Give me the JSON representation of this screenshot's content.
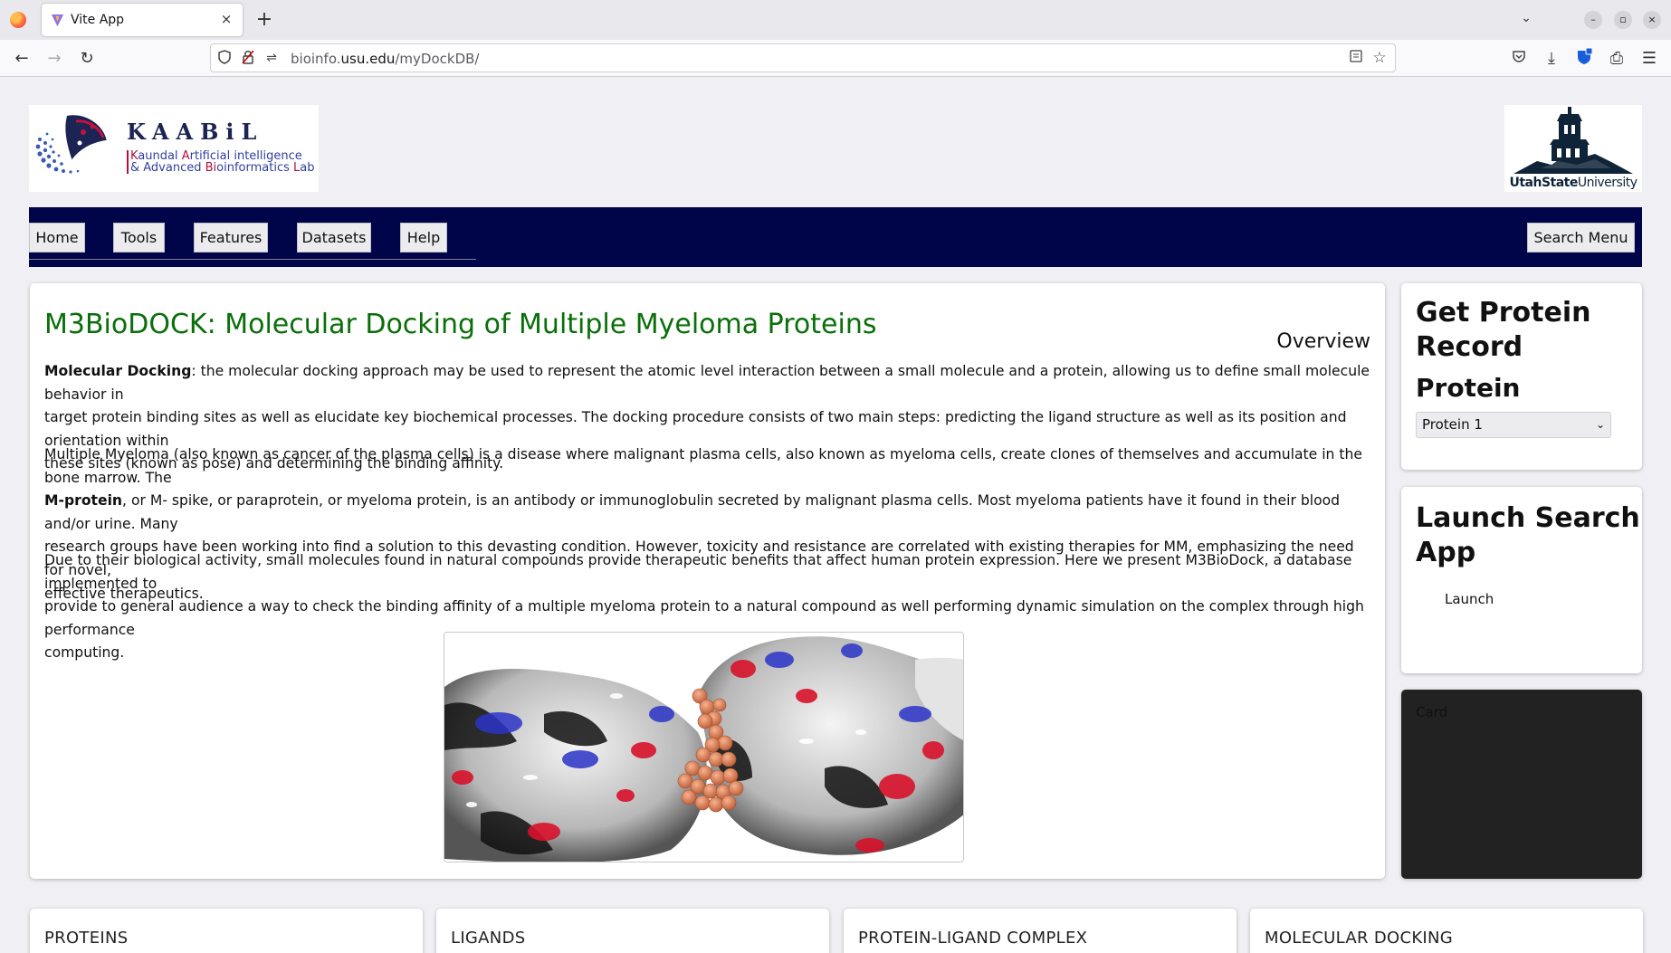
{
  "browser": {
    "tab_title": "Vite App",
    "tab_close": "×",
    "new_tab": "+",
    "url_host_prefix": "bioinfo.",
    "url_host_main": "usu.edu",
    "url_path": "/myDockDB/"
  },
  "header": {
    "lab_name": "KAABiL",
    "lab_sub_line1_a": "K",
    "lab_sub_line1_b": "aundal ",
    "lab_sub_line1_c": "A",
    "lab_sub_line1_d": "rtificial intelligence",
    "lab_sub_line2_a": "& Advanced ",
    "lab_sub_line2_b": "Bi",
    "lab_sub_line2_c": "oinformatics ",
    "lab_sub_line2_d": "L",
    "lab_sub_line2_e": "ab",
    "usu_bold": "UtahState",
    "usu_rest": "University"
  },
  "nav": {
    "items": [
      "Home",
      "Tools",
      "Features",
      "Datasets",
      "Help"
    ],
    "search_menu": "Search Menu"
  },
  "main": {
    "title": "M3BioDOCK: Molecular Docking of Multiple Myeloma Proteins",
    "overview": "Overview",
    "p1_bold": "Molecular Docking",
    "p1_line1": ": the molecular docking approach may be used to represent the atomic level interaction between a small molecule and a protein, allowing us to define small molecule behavior in",
    "p1_line2": "target protein binding sites as well as elucidate key biochemical processes. The docking procedure consists of two main steps: predicting the ligand structure as well as its position and orientation within",
    "p1_line3": "these sites (known as pose) and determining the binding affinity.",
    "p2_line1": "Multiple Myeloma (also known as cancer of the plasma cells) is a disease where malignant plasma cells, also known as myeloma cells, create clones of themselves and accumulate in the bone marrow. The",
    "p2_bold": "M-protein",
    "p2_line2": ", or M- spike, or paraprotein, or myeloma protein, is an antibody or immunoglobulin secreted by malignant plasma cells. Most myeloma patients have it found in their blood and/or urine. Many",
    "p2_line3": "research groups have been working into find a solution to this devasting condition. However, toxicity and resistance are correlated with existing therapies for MM, emphasizing the need for novel,",
    "p2_line4": "effective therapeutics.",
    "p3_line1": "Due to their biological activity, small molecules found in natural compounds provide therapeutic benefits that affect human protein expression. Here we present M3BioDock, a database implemented to",
    "p3_line2": "provide to general audience a way to check the binding affinity of a multiple myeloma protein to a natural compound as well performing dynamic simulation on the complex through high performance",
    "p3_line3": "computing."
  },
  "sidebar": {
    "record_title_l1": "Get Protein",
    "record_title_l2": "Record",
    "protein_label": "Protein",
    "protein_selected": "Protein 1",
    "launch_title_l1": "Launch Search",
    "launch_title_l2": "App",
    "launch_link": "Launch",
    "dark_card_text": "Card"
  },
  "bottom_cards": [
    "PROTEINS",
    "LIGANDS",
    "PROTEIN-LIGAND COMPLEX",
    "MOLECULAR DOCKING"
  ],
  "icons": {
    "back": "back-arrow-icon",
    "forward": "forward-arrow-icon",
    "reload": "reload-icon",
    "shield": "tracking-protection-icon",
    "reader": "reader-view-icon",
    "bookmark": "star-icon",
    "pocket": "pocket-icon",
    "download": "download-icon",
    "extensions": "extensions-icon",
    "menu": "hamburger-menu-icon"
  },
  "colors": {
    "nav_bg": "#000448",
    "title_green": "#0a6f0a",
    "dark_card": "#222222"
  }
}
